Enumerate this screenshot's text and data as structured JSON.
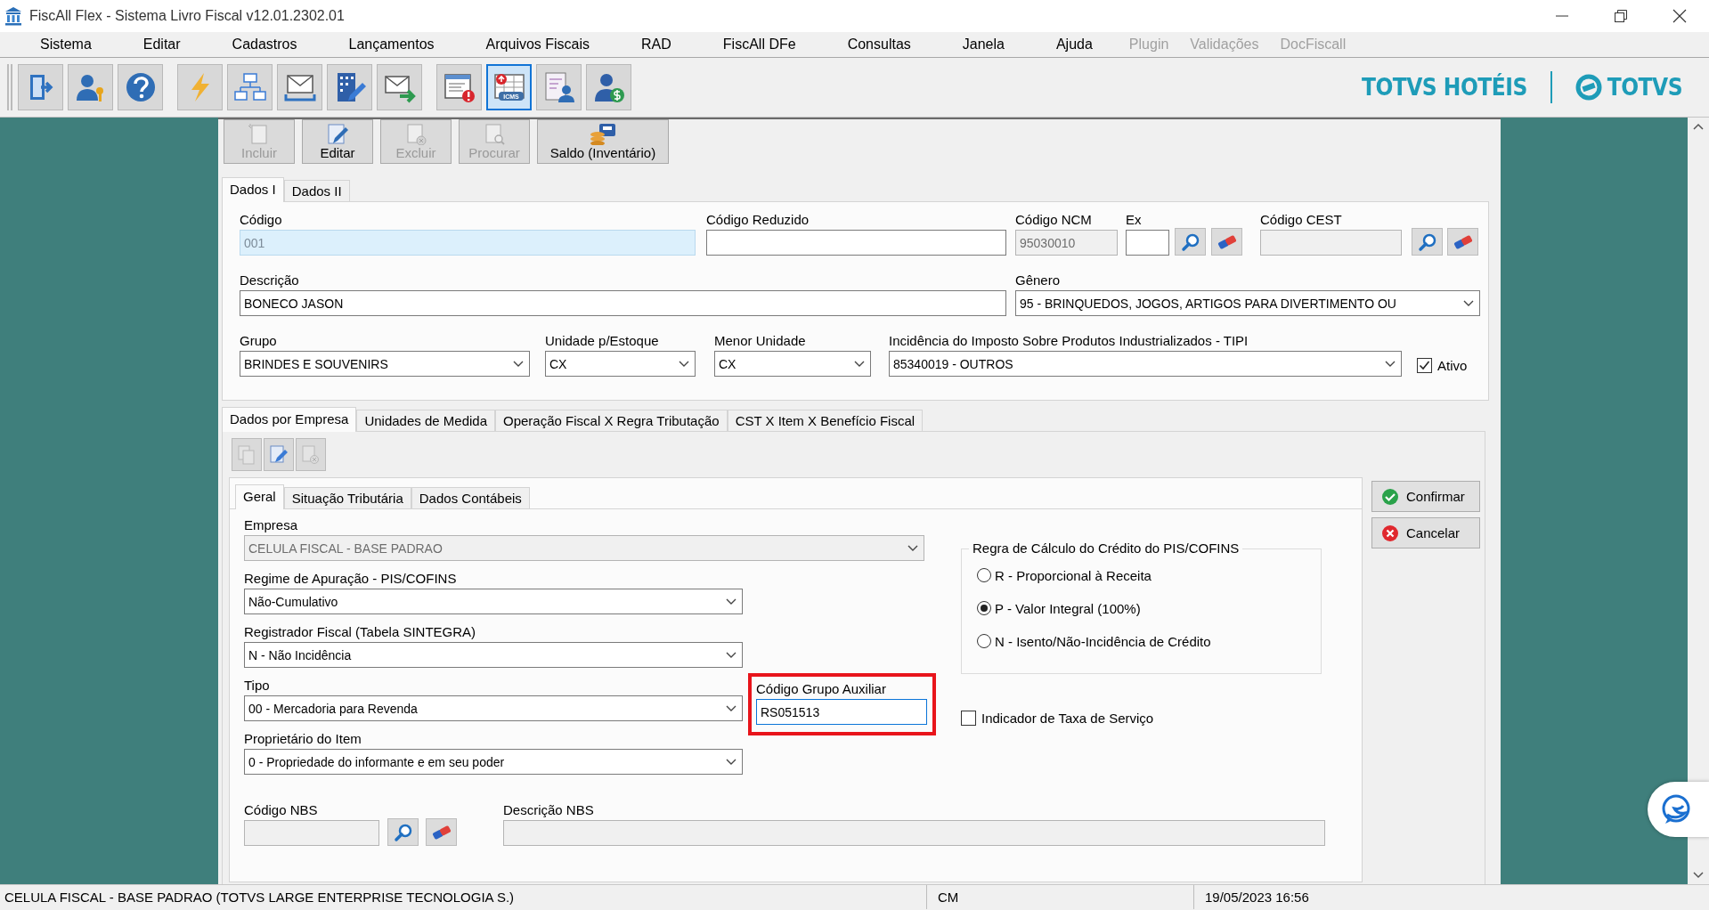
{
  "window": {
    "title": "FiscAll Flex - Sistema Livro Fiscal v12.01.2302.01"
  },
  "menu": [
    {
      "label": "Sistema",
      "disabled": false
    },
    {
      "label": "Editar",
      "disabled": false
    },
    {
      "label": "Cadastros",
      "disabled": false
    },
    {
      "label": "Lançamentos",
      "disabled": false
    },
    {
      "label": "Arquivos Fiscais",
      "disabled": false
    },
    {
      "label": "RAD",
      "disabled": false
    },
    {
      "label": "FiscAll DFe",
      "disabled": false
    },
    {
      "label": "Consultas",
      "disabled": false
    },
    {
      "label": "Janela",
      "disabled": false
    },
    {
      "label": "Ajuda",
      "disabled": false
    },
    {
      "label": "Plugin",
      "disabled": true
    },
    {
      "label": "Validações",
      "disabled": true
    },
    {
      "label": "DocFiscall",
      "disabled": true
    }
  ],
  "toolbar": {
    "groups": [
      {
        "buttons": [
          {
            "kind": "exit",
            "selected": false
          },
          {
            "kind": "user-key",
            "selected": false
          },
          {
            "kind": "help",
            "selected": false
          }
        ]
      },
      {
        "buttons": [
          {
            "kind": "lightning",
            "selected": false
          },
          {
            "kind": "org-chart",
            "selected": false
          },
          {
            "kind": "inbox",
            "selected": false
          },
          {
            "kind": "building",
            "selected": false
          },
          {
            "kind": "envelope-send",
            "selected": false
          }
        ]
      },
      {
        "buttons": [
          {
            "kind": "window-alert",
            "selected": false
          },
          {
            "kind": "table",
            "selected": true,
            "badge": "ICMS"
          },
          {
            "kind": "document-user",
            "selected": false
          },
          {
            "kind": "user-money",
            "selected": false
          }
        ]
      }
    ]
  },
  "brand": {
    "product": "TOTVS HOTÉIS",
    "logo_text": "TOTVS"
  },
  "actions": [
    {
      "label": "Incluir",
      "kind": "new",
      "disabled": true
    },
    {
      "label": "Editar",
      "kind": "edit",
      "disabled": false
    },
    {
      "label": "Excluir",
      "kind": "delete",
      "disabled": true
    },
    {
      "label": "Procurar",
      "kind": "find",
      "disabled": true
    },
    {
      "label": "Saldo (Inventário)",
      "kind": "stock",
      "disabled": false
    }
  ],
  "main_tabs": [
    {
      "label": "Dados I",
      "selected": true
    },
    {
      "label": "Dados II",
      "selected": false
    }
  ],
  "dados_i": {
    "codigo": {
      "label": "Código",
      "value": "001",
      "kind": "text",
      "readonly": true
    },
    "codigo_reduzido": {
      "label": "Código Reduzido",
      "kind": "text"
    },
    "codigo_ncm": {
      "label": "Código NCM",
      "value": "95030010",
      "kind": "text",
      "disabled": true
    },
    "ex": {
      "label": "Ex",
      "kind": "text"
    },
    "codigo_cest": {
      "label": "Código CEST",
      "kind": "text",
      "disabled": true
    },
    "descricao": {
      "label": "Descrição",
      "value": "BONECO JASON",
      "kind": "text"
    },
    "genero": {
      "label": "Gênero",
      "value": "95 - BRINQUEDOS, JOGOS, ARTIGOS PARA DIVERTIMENTO OU",
      "kind": "combo"
    },
    "grupo": {
      "label": "Grupo",
      "value": "BRINDES E SOUVENIRS",
      "kind": "combo"
    },
    "unidade_estoque": {
      "label": "Unidade p/Estoque",
      "value": "CX",
      "kind": "combo"
    },
    "menor_unidade": {
      "label": "Menor Unidade",
      "value": "CX",
      "kind": "combo"
    },
    "tipi": {
      "label": "Incidência do Imposto Sobre Produtos Industrializados - TIPI",
      "value": "85340019 - OUTROS",
      "kind": "combo"
    },
    "ativo": {
      "label": "Ativo",
      "checked": true
    }
  },
  "sub_tabs": [
    {
      "label": "Dados por Empresa",
      "selected": true
    },
    {
      "label": "Unidades de Medida",
      "selected": false
    },
    {
      "label": "Operação Fiscal X Regra Tributação",
      "selected": false
    },
    {
      "label": "CST X Item X Benefício Fiscal",
      "selected": false
    }
  ],
  "sub_toolbar": [
    {
      "kind": "copy",
      "disabled": true
    },
    {
      "kind": "edit",
      "disabled": false
    },
    {
      "kind": "delete",
      "disabled": true
    }
  ],
  "inner_tabs": [
    {
      "label": "Geral",
      "selected": true
    },
    {
      "label": "Situação Tributária",
      "selected": false
    },
    {
      "label": "Dados Contábeis",
      "selected": false
    }
  ],
  "geral": {
    "empresa": {
      "label": "Empresa",
      "value": "CELULA FISCAL - BASE PADRAO",
      "kind": "combo",
      "disabled": true
    },
    "regime": {
      "label": "Regime de Apuração - PIS/COFINS",
      "value": "Não-Cumulativo",
      "kind": "combo"
    },
    "registrador": {
      "label": "Registrador Fiscal (Tabela SINTEGRA)",
      "value": "N - Não Incidência",
      "kind": "combo"
    },
    "tipo": {
      "label": "Tipo",
      "value": "00 - Mercadoria para Revenda",
      "kind": "combo"
    },
    "grupo_auxiliar": {
      "label": "Código Grupo Auxiliar",
      "value": "RS051513",
      "kind": "text",
      "focused": true,
      "highlighted": true
    },
    "proprietario": {
      "label": "Proprietário do Item",
      "value": "0 - Propriedade do informante e em seu poder",
      "kind": "combo"
    },
    "codigo_nbs": {
      "label": "Código NBS",
      "kind": "text",
      "disabled": true
    },
    "descricao_nbs": {
      "label": "Descrição NBS",
      "kind": "text",
      "disabled": true
    },
    "regra_credito": {
      "title": "Regra de Cálculo do Crédito do PIS/COFINS",
      "options": [
        {
          "label": "R - Proporcional à Receita",
          "selected": false
        },
        {
          "label": "P - Valor Integral (100%)",
          "selected": true
        },
        {
          "label": "N - Isento/Não-Incidência de Crédito",
          "selected": false
        }
      ]
    },
    "indicador_taxa": {
      "label": "Indicador de Taxa de Serviço",
      "checked": false
    }
  },
  "side_buttons": [
    {
      "label": "Confirmar",
      "kind": "confirm"
    },
    {
      "label": "Cancelar",
      "kind": "cancel"
    }
  ],
  "status_bar": {
    "company": "CELULA FISCAL - BASE PADRAO (TOTVS LARGE ENTERPRISE TECNOLOGIA S.)",
    "user": "CM",
    "datetime": "19/05/2023 16:56"
  }
}
